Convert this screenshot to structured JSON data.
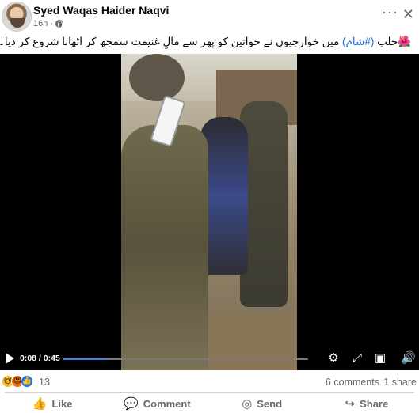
{
  "post": {
    "author": "Syed Waqas Haider Naqvi",
    "time": "16h",
    "privacy_icon": "globe-icon",
    "caption_flower": "🌺",
    "caption_city": "حلب",
    "caption_hashtag": "(#شام)",
    "caption_text": "میں خوارجیوں نے خواتین کو پھر سے مالِ غنیمت سمجھ کر اٹھانا شروع کر دیا۔"
  },
  "video": {
    "time_display": "0:08 / 0:45",
    "progress_fraction": 0.178
  },
  "stats": {
    "reaction_count": "13",
    "comments": "6 comments",
    "shares": "1 share",
    "reaction_icons": [
      "sad-icon",
      "angry-icon",
      "like-icon"
    ]
  },
  "actions": {
    "like": "Like",
    "comment": "Comment",
    "send": "Send",
    "share": "Share"
  }
}
